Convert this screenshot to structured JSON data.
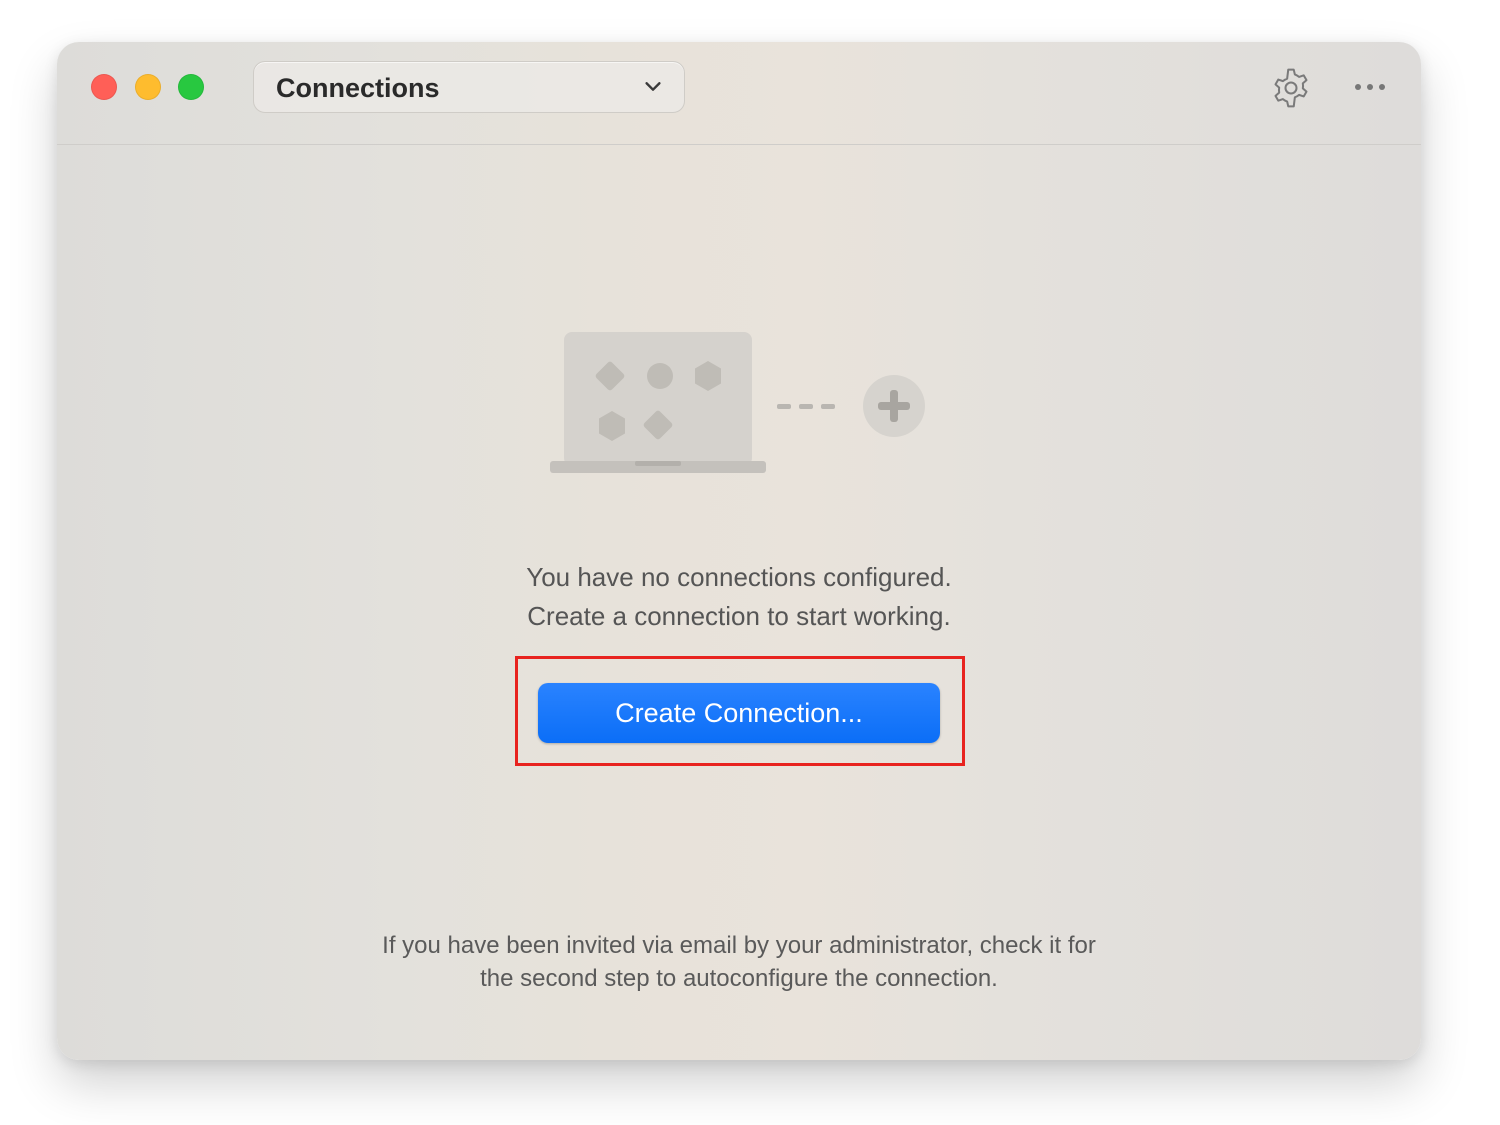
{
  "window": {
    "controls": [
      "close",
      "minimize",
      "zoom"
    ]
  },
  "toolbar": {
    "selector_label": "Connections",
    "selector_icon": "chevron-down-icon",
    "settings_icon": "gear-icon",
    "more_icon": "ellipsis-icon"
  },
  "empty_state": {
    "illustration": "laptop-with-shapes-and-plus-icon",
    "message_line1": "You have no connections configured.",
    "message_line2": "Create a connection to start working.",
    "button_label": "Create Connection...",
    "note_line1": "If you have been invited via email by your administrator, check it for",
    "note_line2": "the second step to autoconfigure the connection."
  },
  "colors": {
    "primary_button": "#0b6ef7",
    "highlight_border": "#e8231f",
    "close": "#ff5f57",
    "minimize": "#febc2e",
    "zoom": "#28c840"
  }
}
